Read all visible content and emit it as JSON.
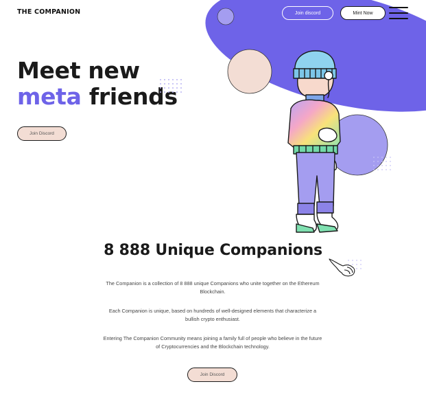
{
  "header": {
    "logo": "THE COMPANION",
    "join_discord_label": "Join discord",
    "mint_now_label": "Mint Now"
  },
  "hero": {
    "title_line1": "Meet new",
    "title_accent": "meta",
    "title_rest": " friends",
    "cta_label": "Join Discord"
  },
  "about": {
    "title": "8 888 Unique Companions",
    "paragraphs": [
      "The Companion is a collection of 8 888 unique Companions who unite together on the Ethereum Blockchain.",
      "Each Companion is unique, based on hundreds of well-designed elements that characterize a bullish crypto enthusiast.",
      "Entering The Companion Community means joining a family full of people who believe in the future of Cryptocurrencies and the Blockchain technology."
    ],
    "cta_label": "Join Discord"
  },
  "colors": {
    "accent": "#6e63e8",
    "lavender": "#a49df0",
    "peach": "#f3ddd4"
  },
  "icons": [
    "menu-icon",
    "companion-character",
    "pointing-hand-icon"
  ]
}
